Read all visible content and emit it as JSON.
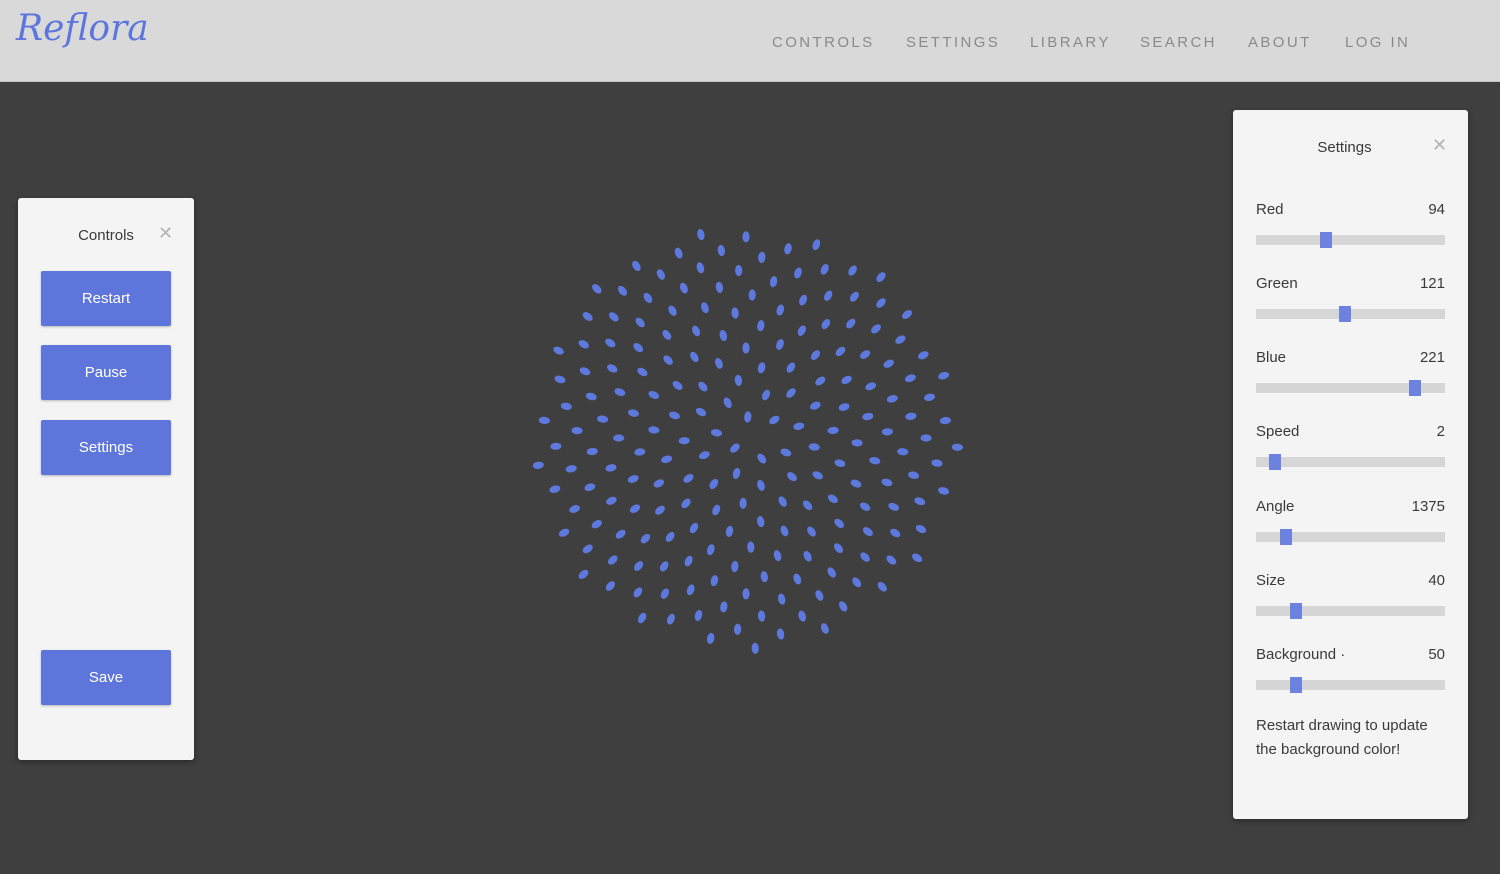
{
  "app": {
    "logo_text": "Reflora",
    "accent_color": "#5e76dc",
    "petal_color": "#5e79dd",
    "canvas_background": "#3f3f3f"
  },
  "nav": {
    "items": [
      "CONTROLS",
      "SETTINGS",
      "LIBRARY",
      "SEARCH",
      "ABOUT",
      "LOG IN"
    ]
  },
  "controls": {
    "title": "Controls",
    "close_icon": "close-icon",
    "buttons": {
      "restart": "Restart",
      "pause": "Pause",
      "settings": "Settings",
      "save": "Save"
    }
  },
  "settings": {
    "title": "Settings",
    "close_icon": "close-icon",
    "sliders": [
      {
        "label": "Red",
        "value": "94",
        "position": 0.37
      },
      {
        "label": "Green",
        "value": "121",
        "position": 0.47
      },
      {
        "label": "Blue",
        "value": "221",
        "position": 0.84
      },
      {
        "label": "Speed",
        "value": "2",
        "position": 0.1
      },
      {
        "label": "Angle",
        "value": "1375",
        "position": 0.16
      },
      {
        "label": "Size",
        "value": "40",
        "position": 0.21
      },
      {
        "label": "Background ·",
        "value": "50",
        "position": 0.21
      }
    ],
    "note": "Restart drawing to update the background color!"
  }
}
